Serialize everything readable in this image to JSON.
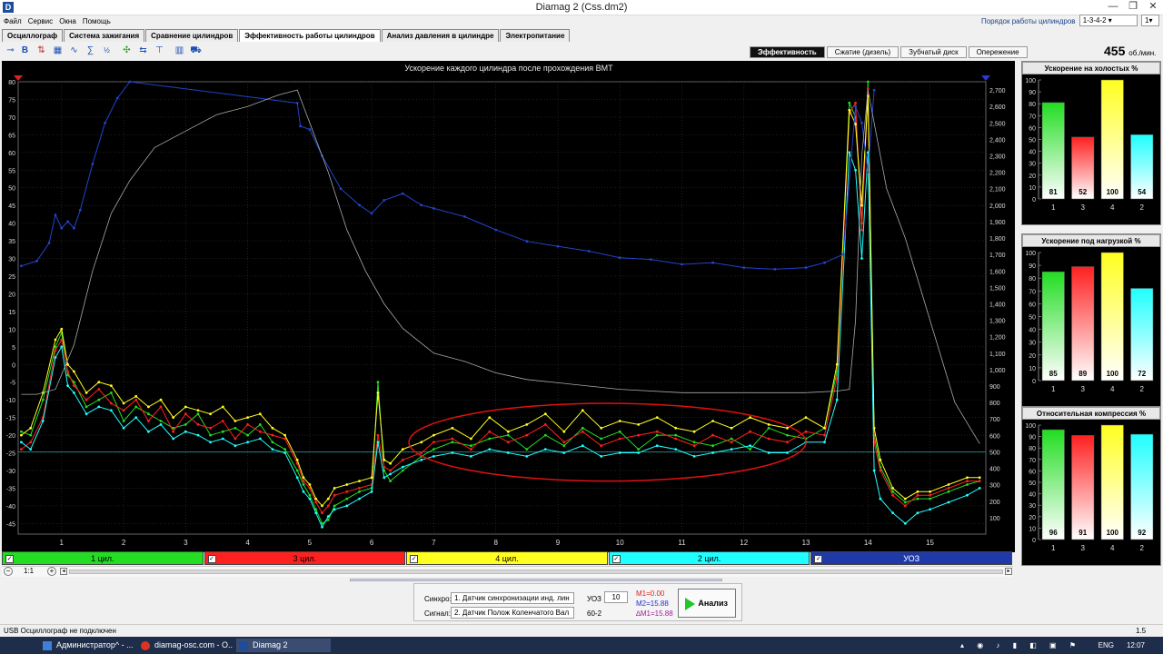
{
  "window": {
    "title": "Diamag 2 (Css.dm2)",
    "app_icon": "D"
  },
  "menu": [
    "Файл",
    "Сервис",
    "Окна",
    "Помощь"
  ],
  "firing_order": {
    "label": "Порядок работы цилиндров",
    "value": "1-3-4-2",
    "count": "1"
  },
  "tabs": [
    {
      "label": "Осциллограф",
      "active": false
    },
    {
      "label": "Система зажигания",
      "active": false
    },
    {
      "label": "Сравнение цилиндров",
      "active": false
    },
    {
      "label": "Эффективность работы цилиндров",
      "active": true
    },
    {
      "label": "Анализ давления в цилиндре",
      "active": false
    },
    {
      "label": "Электропитание",
      "active": false
    }
  ],
  "right_tabs": [
    {
      "label": "Эффективность",
      "active": true
    },
    {
      "label": "Сжатие (дизель)",
      "active": false
    },
    {
      "label": "Зубчатый диск",
      "active": false
    },
    {
      "label": "Опережение",
      "active": false
    }
  ],
  "rpm": {
    "value": "455",
    "unit": "об./мин."
  },
  "chart_data": {
    "type": "line",
    "title": "Ускорение каждого цилиндра после прохождения ВМТ",
    "x_ticks": [
      "1",
      "2",
      "3",
      "4",
      "5",
      "6",
      "7",
      "8",
      "9",
      "10",
      "11",
      "12",
      "13",
      "14",
      "15"
    ],
    "y_left_ticks": [
      "80",
      "75",
      "70",
      "65",
      "60",
      "55",
      "50",
      "45",
      "40",
      "35",
      "30",
      "25",
      "20",
      "15",
      "10",
      "5",
      "0",
      "-5",
      "-10",
      "-15",
      "-20",
      "-25",
      "-30",
      "-35",
      "-40",
      "-45"
    ],
    "y_right_ticks": [
      "2,700",
      "2,600",
      "2,500",
      "2,400",
      "2,300",
      "2,200",
      "2,100",
      "2,000",
      "1,900",
      "1,800",
      "1,700",
      "1,600",
      "1,500",
      "1,400",
      "1,300",
      "1,200",
      "1,100",
      "1,000",
      "900",
      "800",
      "700",
      "600",
      "500",
      "400",
      "300",
      "200",
      "100"
    ],
    "ylim": [
      -48,
      80
    ],
    "xlim": [
      0.3,
      15.9
    ],
    "y2lim": [
      0,
      2750
    ],
    "grid": true,
    "series": [
      {
        "name": "1 цил.",
        "color": "#22dd22",
        "x": [
          0.35,
          0.5,
          0.7,
          0.9,
          1.0,
          1.1,
          1.2,
          1.4,
          1.6,
          1.8,
          2.0,
          2.2,
          2.4,
          2.6,
          2.8,
          3.0,
          3.2,
          3.4,
          3.6,
          3.8,
          4.0,
          4.2,
          4.4,
          4.6,
          4.8,
          4.9,
          5.0,
          5.1,
          5.2,
          5.3,
          5.4,
          5.6,
          5.8,
          6.0,
          6.1,
          6.2,
          6.3,
          6.5,
          6.8,
          7.0,
          7.3,
          7.6,
          7.9,
          8.2,
          8.5,
          8.8,
          9.1,
          9.4,
          9.7,
          10.0,
          10.3,
          10.6,
          10.9,
          11.2,
          11.5,
          11.8,
          12.1,
          12.4,
          12.7,
          13.0,
          13.3,
          13.5,
          13.7,
          13.8,
          13.9,
          14.0,
          14.1,
          14.2,
          14.4,
          14.6,
          14.8,
          15.0,
          15.3,
          15.6,
          15.8
        ],
        "y": [
          -19,
          -20,
          -10,
          5,
          9,
          -3,
          -5,
          -12,
          -10,
          -8,
          -16,
          -12,
          -14,
          -16,
          -18,
          -17,
          -14,
          -20,
          -19,
          -18,
          -20,
          -17,
          -22,
          -24,
          -30,
          -34,
          -37,
          -41,
          -45,
          -44,
          -40,
          -38,
          -36,
          -35,
          -5,
          -30,
          -33,
          -30,
          -26,
          -24,
          -22,
          -23,
          -21,
          -20,
          -24,
          -20,
          -23,
          -18,
          -21,
          -19,
          -24,
          -20,
          -20,
          -22,
          -23,
          -21,
          -24,
          -18,
          -20,
          -21,
          -18,
          -2,
          74,
          70,
          40,
          80,
          -20,
          -29,
          -36,
          -39,
          -38,
          -38,
          -36,
          -34,
          -33
        ]
      },
      {
        "name": "3 цил.",
        "color": "#ff2020",
        "x": [
          0.35,
          0.5,
          0.7,
          0.9,
          1.0,
          1.1,
          1.2,
          1.4,
          1.6,
          1.8,
          2.0,
          2.2,
          2.4,
          2.6,
          2.8,
          3.0,
          3.2,
          3.4,
          3.6,
          3.8,
          4.0,
          4.2,
          4.4,
          4.6,
          4.8,
          4.9,
          5.0,
          5.1,
          5.2,
          5.3,
          5.4,
          5.6,
          5.8,
          6.0,
          6.1,
          6.2,
          6.3,
          6.5,
          6.8,
          7.0,
          7.3,
          7.6,
          7.9,
          8.2,
          8.5,
          8.8,
          9.1,
          9.4,
          9.7,
          10.0,
          10.3,
          10.6,
          10.9,
          11.2,
          11.5,
          11.8,
          12.1,
          12.4,
          12.7,
          13.0,
          13.3,
          13.5,
          13.7,
          13.8,
          13.9,
          14.0,
          14.1,
          14.2,
          14.4,
          14.6,
          14.8,
          15.0,
          15.3,
          15.6,
          15.8
        ],
        "y": [
          -24,
          -22,
          -15,
          4,
          7,
          -2,
          -6,
          -10,
          -7,
          -11,
          -13,
          -10,
          -16,
          -12,
          -19,
          -14,
          -17,
          -18,
          -16,
          -21,
          -17,
          -19,
          -20,
          -21,
          -28,
          -33,
          -35,
          -39,
          -42,
          -40,
          -37,
          -36,
          -35,
          -34,
          -20,
          -29,
          -30,
          -27,
          -25,
          -22,
          -21,
          -24,
          -19,
          -22,
          -20,
          -17,
          -22,
          -19,
          -23,
          -21,
          -20,
          -19,
          -21,
          -23,
          -20,
          -22,
          -19,
          -21,
          -22,
          -19,
          -20,
          -4,
          71,
          74,
          38,
          78,
          -22,
          -30,
          -37,
          -40,
          -37,
          -37,
          -35,
          -33,
          -33
        ]
      },
      {
        "name": "4 цил.",
        "color": "#ffff20",
        "x": [
          0.35,
          0.5,
          0.7,
          0.9,
          1.0,
          1.1,
          1.2,
          1.4,
          1.6,
          1.8,
          2.0,
          2.2,
          2.4,
          2.6,
          2.8,
          3.0,
          3.2,
          3.4,
          3.6,
          3.8,
          4.0,
          4.2,
          4.4,
          4.6,
          4.8,
          4.9,
          5.0,
          5.1,
          5.2,
          5.3,
          5.4,
          5.6,
          5.8,
          6.0,
          6.1,
          6.2,
          6.3,
          6.5,
          6.8,
          7.0,
          7.3,
          7.6,
          7.9,
          8.2,
          8.5,
          8.8,
          9.1,
          9.4,
          9.7,
          10.0,
          10.3,
          10.6,
          10.9,
          11.2,
          11.5,
          11.8,
          12.1,
          12.4,
          12.7,
          13.0,
          13.3,
          13.5,
          13.7,
          13.8,
          13.9,
          14.0,
          14.1,
          14.2,
          14.4,
          14.6,
          14.8,
          15.0,
          15.3,
          15.6,
          15.8
        ],
        "y": [
          -20,
          -18,
          -8,
          7,
          10,
          0,
          -2,
          -8,
          -5,
          -6,
          -11,
          -9,
          -12,
          -10,
          -15,
          -12,
          -13,
          -14,
          -12,
          -16,
          -15,
          -14,
          -18,
          -20,
          -27,
          -32,
          -34,
          -38,
          -40,
          -38,
          -35,
          -34,
          -33,
          -32,
          -8,
          -27,
          -28,
          -24,
          -22,
          -20,
          -18,
          -21,
          -15,
          -19,
          -17,
          -14,
          -19,
          -13,
          -18,
          -16,
          -17,
          -15,
          -18,
          -19,
          -16,
          -18,
          -15,
          -17,
          -18,
          -15,
          -18,
          0,
          72,
          68,
          45,
          76,
          -18,
          -27,
          -35,
          -38,
          -36,
          -36,
          -34,
          -32,
          -32
        ]
      },
      {
        "name": "2 цил.",
        "color": "#20ffff",
        "x": [
          0.35,
          0.5,
          0.7,
          0.9,
          1.0,
          1.1,
          1.2,
          1.4,
          1.6,
          1.8,
          2.0,
          2.2,
          2.4,
          2.6,
          2.8,
          3.0,
          3.2,
          3.4,
          3.6,
          3.8,
          4.0,
          4.2,
          4.4,
          4.6,
          4.8,
          4.9,
          5.0,
          5.1,
          5.2,
          5.3,
          5.4,
          5.6,
          5.8,
          6.0,
          6.1,
          6.2,
          6.3,
          6.5,
          6.8,
          7.0,
          7.3,
          7.6,
          7.9,
          8.2,
          8.5,
          8.8,
          9.1,
          9.4,
          9.7,
          10.0,
          10.3,
          10.6,
          10.9,
          11.2,
          11.5,
          11.8,
          12.1,
          12.4,
          12.7,
          13.0,
          13.3,
          13.5,
          13.7,
          13.8,
          13.9,
          14.0,
          14.1,
          14.2,
          14.4,
          14.6,
          14.8,
          15.0,
          15.3,
          15.6,
          15.8
        ],
        "y": [
          -22,
          -24,
          -16,
          2,
          5,
          -6,
          -8,
          -14,
          -12,
          -13,
          -18,
          -15,
          -19,
          -17,
          -21,
          -19,
          -20,
          -22,
          -21,
          -23,
          -22,
          -21,
          -24,
          -25,
          -32,
          -36,
          -38,
          -42,
          -46,
          -43,
          -41,
          -40,
          -38,
          -36,
          -22,
          -32,
          -31,
          -29,
          -27,
          -26,
          -25,
          -26,
          -24,
          -25,
          -26,
          -24,
          -25,
          -23,
          -26,
          -25,
          -25,
          -23,
          -24,
          -26,
          -25,
          -24,
          -23,
          -25,
          -25,
          -22,
          -22,
          -10,
          60,
          55,
          30,
          60,
          -30,
          -38,
          -42,
          -45,
          -42,
          -41,
          -39,
          -37,
          -35
        ]
      },
      {
        "name": "УОЗ",
        "color": "#2244cc",
        "axis": "right",
        "x": [
          0.35,
          0.6,
          0.8,
          0.9,
          1.0,
          1.1,
          1.2,
          1.3,
          1.5,
          1.7,
          1.9,
          2.1,
          4.8,
          4.85,
          5.0,
          5.2,
          5.5,
          5.8,
          6.0,
          6.2,
          6.5,
          6.8,
          7.0,
          7.5,
          8.0,
          8.5,
          9.0,
          9.5,
          10.0,
          10.5,
          11.0,
          11.5,
          12.0,
          12.5,
          13.0,
          13.3,
          13.6,
          13.8,
          13.9,
          14.0,
          14.1
        ],
        "y": [
          1630,
          1660,
          1770,
          1940,
          1860,
          1900,
          1860,
          1970,
          2250,
          2500,
          2650,
          2750,
          2620,
          2480,
          2460,
          2300,
          2100,
          2000,
          1950,
          2030,
          2070,
          2000,
          1980,
          1930,
          1850,
          1780,
          1750,
          1720,
          1680,
          1670,
          1640,
          1650,
          1620,
          1610,
          1620,
          1650,
          1700,
          2600,
          2500,
          2200,
          2700
        ]
      },
      {
        "name": "RPM",
        "color": "#aaaaaa",
        "axis": "right",
        "x": [
          0.35,
          0.6,
          0.9,
          1.2,
          1.5,
          1.8,
          2.1,
          2.5,
          3.0,
          3.5,
          4.0,
          4.5,
          4.8,
          5.0,
          5.3,
          5.6,
          5.9,
          6.2,
          6.5,
          7.0,
          7.5,
          8.0,
          8.5,
          9.0,
          9.5,
          10.0,
          11.0,
          12.0,
          13.0,
          13.5,
          13.7,
          13.8,
          13.9,
          14.0,
          14.1,
          14.3,
          14.6,
          15.0,
          15.4,
          15.8
        ],
        "y": [
          850,
          850,
          880,
          1150,
          1600,
          1950,
          2150,
          2350,
          2450,
          2550,
          2600,
          2670,
          2700,
          2500,
          2200,
          1850,
          1600,
          1400,
          1250,
          1100,
          1050,
          980,
          940,
          920,
          900,
          880,
          860,
          860,
          860,
          870,
          880,
          1300,
          2300,
          2700,
          2500,
          2100,
          1800,
          1300,
          800,
          550
        ]
      }
    ],
    "annotations": [
      {
        "type": "ellipse",
        "color": "#e01010",
        "x_center": 9.8,
        "y_center": -22,
        "x_radius": 3.2,
        "y_radius": 11
      }
    ],
    "zero_line_y2": 500
  },
  "cylinder_bar": [
    {
      "label": "1 цил.",
      "color": "#22dd22"
    },
    {
      "label": "3 цил.",
      "color": "#ff2020"
    },
    {
      "label": "4 цил.",
      "color": "#ffff20"
    },
    {
      "label": "2 цил.",
      "color": "#20ffff"
    },
    {
      "label": "УОЗ",
      "color": "#1f3aa8"
    }
  ],
  "zoom": {
    "label": "1:1"
  },
  "panels": [
    {
      "title": "Ускорение на холостых %",
      "values": [
        81,
        52,
        100,
        54
      ],
      "labels": [
        "1",
        "3",
        "4",
        "2"
      ]
    },
    {
      "title": "Ускорение под нагрузкой %",
      "values": [
        85,
        89,
        100,
        72
      ],
      "labels": [
        "1",
        "3",
        "4",
        "2"
      ]
    },
    {
      "title": "Относительная компрессия %",
      "values": [
        96,
        91,
        100,
        92
      ],
      "labels": [
        "1",
        "3",
        "4",
        "2"
      ]
    }
  ],
  "panel_ticks": [
    "100",
    "90",
    "80",
    "70",
    "60",
    "50",
    "40",
    "30",
    "20",
    "10",
    "0"
  ],
  "bar_colors": [
    "#22dd22",
    "#ff2020",
    "#ffff20",
    "#20ffff"
  ],
  "controls": {
    "sync_label": "Синхро:",
    "sync_value": "1.  Датчик синхронизации инд. лин",
    "signal_label": "Сигнал:",
    "signal_value": "2.  Датчик Полож Коленчатого Вал",
    "uoz_label": "УОЗ",
    "uoz_value": "10",
    "mode": "60-2",
    "m1": "M1=0.00",
    "m2": "M2=15.88",
    "dm": "∆M1=15.88",
    "analyze": "Анализ"
  },
  "status": {
    "left": "USB Осциллограф не подключен",
    "right": "1.5"
  },
  "taskbar": {
    "items": [
      "Администратор^ - ...",
      "diamag-osc.com - O...",
      "Diamag 2"
    ],
    "lang": "ENG",
    "time": "12:07"
  }
}
